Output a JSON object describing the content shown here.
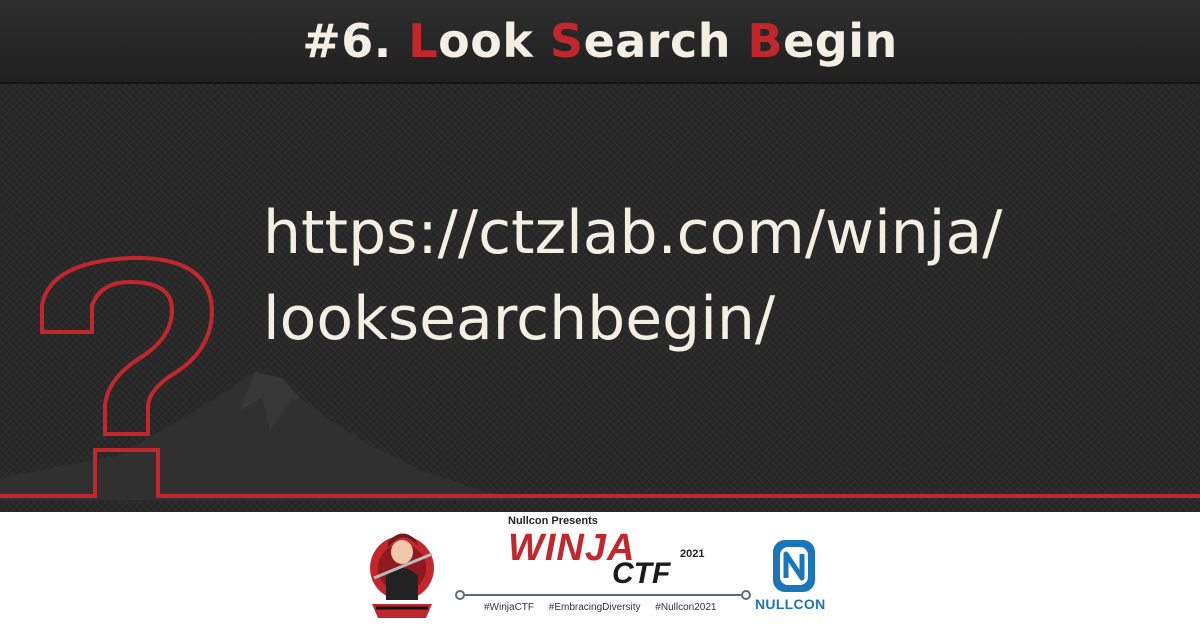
{
  "header": {
    "number": "#6.",
    "words": [
      {
        "initial": "L",
        "rest": "ook"
      },
      {
        "initial": "S",
        "rest": "earch"
      },
      {
        "initial": "B",
        "rest": "egin"
      }
    ]
  },
  "url": {
    "line1": "https://ctzlab.com/winja/",
    "line2": "looksearchbegin/"
  },
  "footer": {
    "presents": "Nullcon Presents",
    "event_name": "WINJA",
    "event_suffix": "CTF",
    "year": "2021",
    "hashtags": [
      "#WinjaCTF",
      "#EmbracingDiversity",
      "#Nullcon2021"
    ],
    "sponsor": "NULLCON"
  },
  "colors": {
    "accent": "#c1272d",
    "background": "#262626",
    "text": "#f4efe3",
    "nullcon_blue": "#1b75bb"
  },
  "icons": [
    "question-mark-icon",
    "mountain-silhouette",
    "ninja-mascot-logo",
    "nullcon-logo-icon"
  ]
}
